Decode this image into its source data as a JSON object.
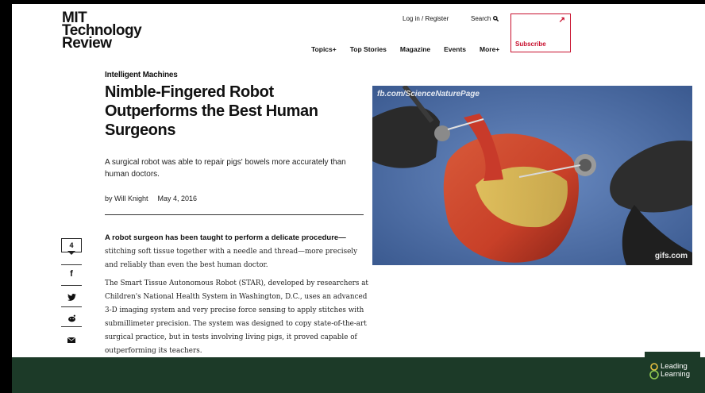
{
  "logo": {
    "line1": "MIT",
    "line2": "Technology",
    "line3": "Review"
  },
  "topnav": {
    "login": "Log in / Register",
    "search": "Search"
  },
  "subscribe": {
    "label": "Subscribe"
  },
  "mainnav": [
    "Topics+",
    "Top Stories",
    "Magazine",
    "Events",
    "More+"
  ],
  "article": {
    "category": "Intelligent Machines",
    "headline": "Nimble-Fingered Robot Outperforms the Best Human Surgeons",
    "dek": "A surgical robot was able to repair pigs' bowels more accurately than human doctors.",
    "author": "by Will Knight",
    "date": "May 4, 2016",
    "lead_bold": "A robot surgeon has been taught to perform a delicate procedure—",
    "lead_rest": "stitching soft tissue together with a needle and thread—more precisely and reliably than even the best human doctor.",
    "para2": "The Smart Tissue Autonomous Robot (STAR), developed by researchers at Children's National Health System in Washington, D.C., uses an advanced 3-D imaging system and very precise force sensing to apply stitches with submillimeter precision. The system was designed to copy state-of-the-art surgical practice, but in tests involving living pigs, it proved capable of outperforming its teachers."
  },
  "share": {
    "count": "4"
  },
  "hero": {
    "watermark_top": "fb.com/ScienceNaturePage",
    "watermark_bottom": "gifs.com"
  },
  "overlay": {
    "line1": "Leading",
    "line2": "Learning"
  },
  "colors": {
    "accent": "#c8102e",
    "footer": "#1c3a28"
  }
}
